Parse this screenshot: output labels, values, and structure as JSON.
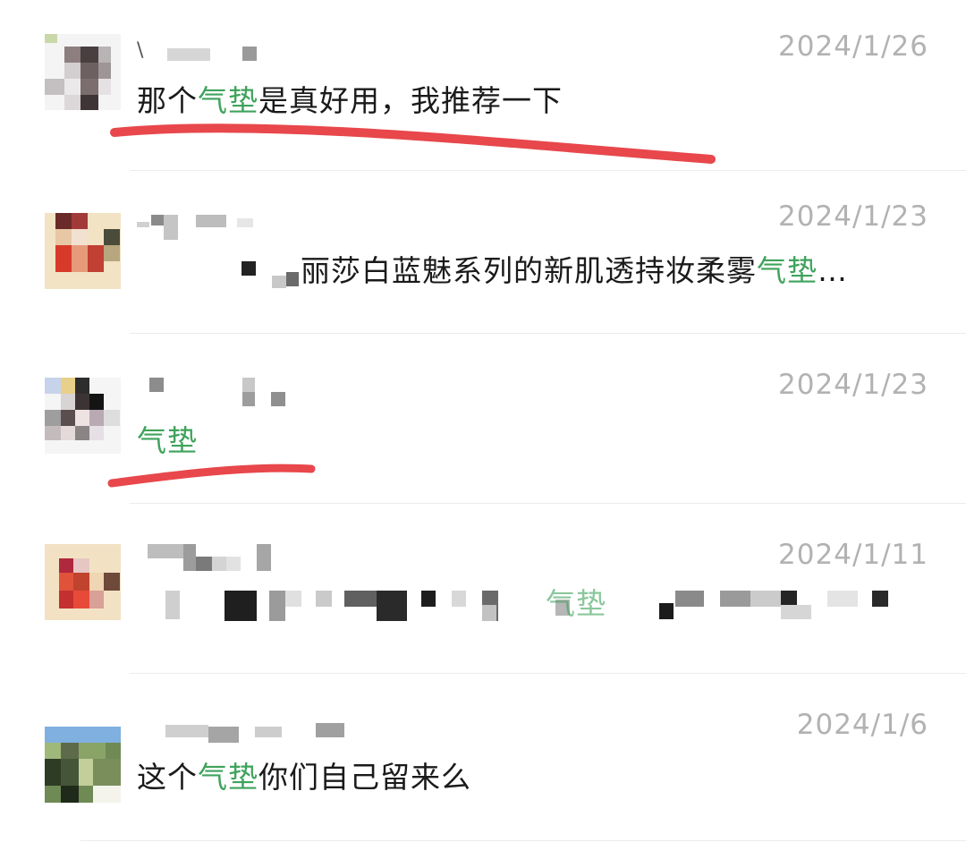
{
  "messages": [
    {
      "time": "2024/1/26",
      "name_visible": "\\",
      "text_before": "那个",
      "keyword": "气垫",
      "text_after": "是真好用，我推荐一下"
    },
    {
      "time": "2024/1/23",
      "text_before": "丽莎白蓝魅系列的新肌透持妆柔雾",
      "keyword": "气垫",
      "text_after": "…"
    },
    {
      "time": "2024/1/23",
      "text_before": "",
      "keyword": "气垫",
      "text_after": ""
    },
    {
      "time": "2024/1/11",
      "text_before": "",
      "keyword": "气垫",
      "text_after": ""
    },
    {
      "time": "2024/1/6",
      "text_before": "这个",
      "keyword": "气垫",
      "text_after": "你们自己留来么"
    }
  ],
  "colors": {
    "keyword": "#3fa35c",
    "timestamp": "#b2b2b2",
    "annotation_underline": "#e8474b"
  }
}
